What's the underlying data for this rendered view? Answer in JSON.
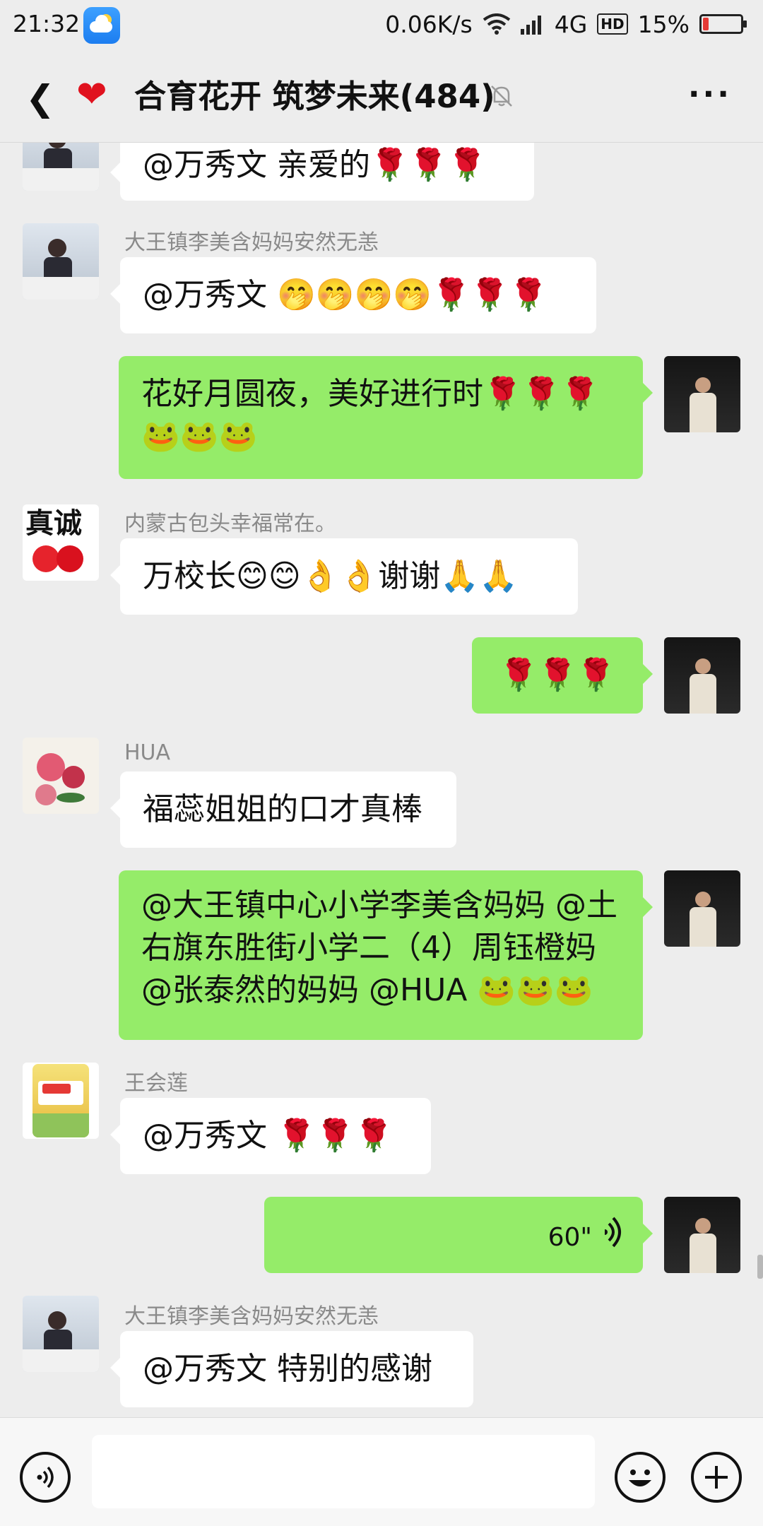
{
  "status_bar": {
    "time": "21:32",
    "net_speed": "0.06K/s",
    "network": "4G",
    "hd": "HD",
    "battery": "15%",
    "battery_level": 0.15
  },
  "header": {
    "title": "合育花开 筑梦未来(484)",
    "back_icon": "back-arrow-icon",
    "heart_icon": "heart-icon",
    "mute_icon": "bell-mute-icon",
    "more_icon": "more-dots-icon"
  },
  "messages": [
    {
      "type": "in",
      "sender": "",
      "text": "@万秀文  亲爱的🌹🌹🌹"
    },
    {
      "type": "in",
      "sender": "大王镇李美含妈妈安然无恙",
      "text": "@万秀文  🤭🤭🤭🤭🌹🌹🌹"
    },
    {
      "type": "out",
      "line1": "花好月圆夜，美好进行时🌹🌹🌹",
      "line2": "🐸🐸🐸"
    },
    {
      "type": "in",
      "sender": "内蒙古包头幸福常在。",
      "text": "万校长😊😊👌👌谢谢🙏🙏"
    },
    {
      "type": "out",
      "text": "🌹🌹🌹"
    },
    {
      "type": "in",
      "sender": "HUA",
      "text": "福蕊姐姐的口才真棒"
    },
    {
      "type": "out",
      "line1": "@大王镇中心小学李美含妈妈 @土",
      "line2": "右旗东胜街小学二（4）周钰橙妈",
      "line3": "@张泰然的妈妈  @HUA 🐸🐸🐸"
    },
    {
      "type": "in",
      "sender": "王会莲",
      "text": "@万秀文  🌹🌹🌹"
    },
    {
      "type": "voice",
      "duration": "60\""
    },
    {
      "type": "in",
      "sender": "大王镇李美含妈妈安然无恙",
      "text": "@万秀文  特别的感谢"
    }
  ],
  "input_bar": {
    "voice_icon": "voice-input-icon",
    "input_value": "",
    "emoji_icon": "emoji-icon",
    "plus_icon": "plus-icon"
  }
}
